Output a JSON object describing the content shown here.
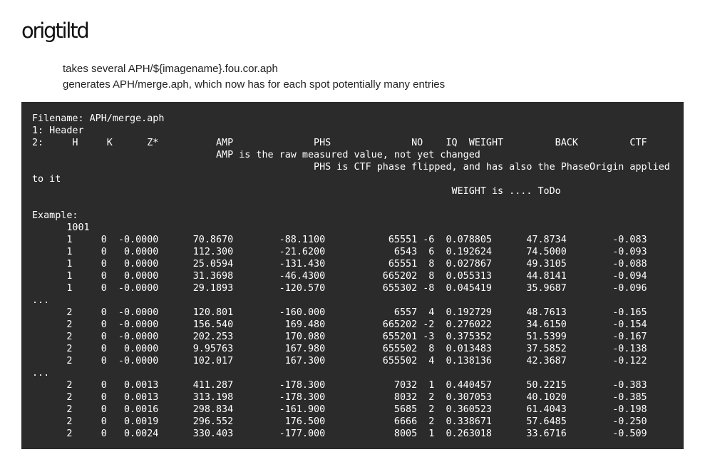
{
  "page": {
    "title": "origtiltd",
    "description": [
      "takes several APH/${imagename}.fou.cor.aph",
      "generates APH/merge.aph, which now has for each spot potentially many entries"
    ]
  },
  "code_block": {
    "lines": [
      "Filename: APH/merge.aph",
      "1: Header",
      "2:     H     K      Z*          AMP              PHS              NO    IQ  WEIGHT         BACK         CTF",
      "                                AMP is the raw measured value, not yet changed",
      "                                                 PHS is CTF phase flipped, and has also the PhaseOrigin applied",
      "to it",
      "                                                                         WEIGHT is .... ToDo",
      "",
      "Example:",
      "      1001",
      "      1     0  -0.0000      70.8670        -88.1100           65551 -6  0.078805      47.8734        -0.083",
      "      1     0   0.0000      112.300        -21.6200            6543  6  0.192624      74.5000        -0.093",
      "      1     0   0.0000      25.0594        -131.430           65551  8  0.027867      49.3105        -0.088",
      "      1     0   0.0000      31.3698        -46.4300          665202  8  0.055313      44.8141        -0.094",
      "      1     0  -0.0000      29.1893        -120.570          655302 -8  0.045419      35.9687        -0.096",
      "...",
      "      2     0  -0.0000      120.801        -160.000            6557  4  0.192729      48.7613        -0.165",
      "      2     0  -0.0000      156.540         169.480          665202 -2  0.276022      34.6150        -0.154",
      "      2     0  -0.0000      202.253         170.080          655201 -3  0.375352      51.5399        -0.167",
      "      2     0   0.0000      9.95763         167.980          655502  8  0.013483      37.5852        -0.138",
      "      2     0  -0.0000      102.017         167.300          655502  4  0.138136      42.3687        -0.122",
      "...",
      "      2     0   0.0013      411.287        -178.300            7032  1  0.440457      50.2215        -0.383",
      "      2     0   0.0013      313.198        -178.300            8032  2  0.307053      40.1020        -0.385",
      "      2     0   0.0016      298.834        -161.900            5685  2  0.360523      61.4043        -0.198",
      "      2     0   0.0019      296.552         176.500            6666  2  0.338671      57.6485        -0.250",
      "      2     0   0.0024      330.403        -177.000            8005  1  0.263018      33.6716        -0.509"
    ]
  }
}
